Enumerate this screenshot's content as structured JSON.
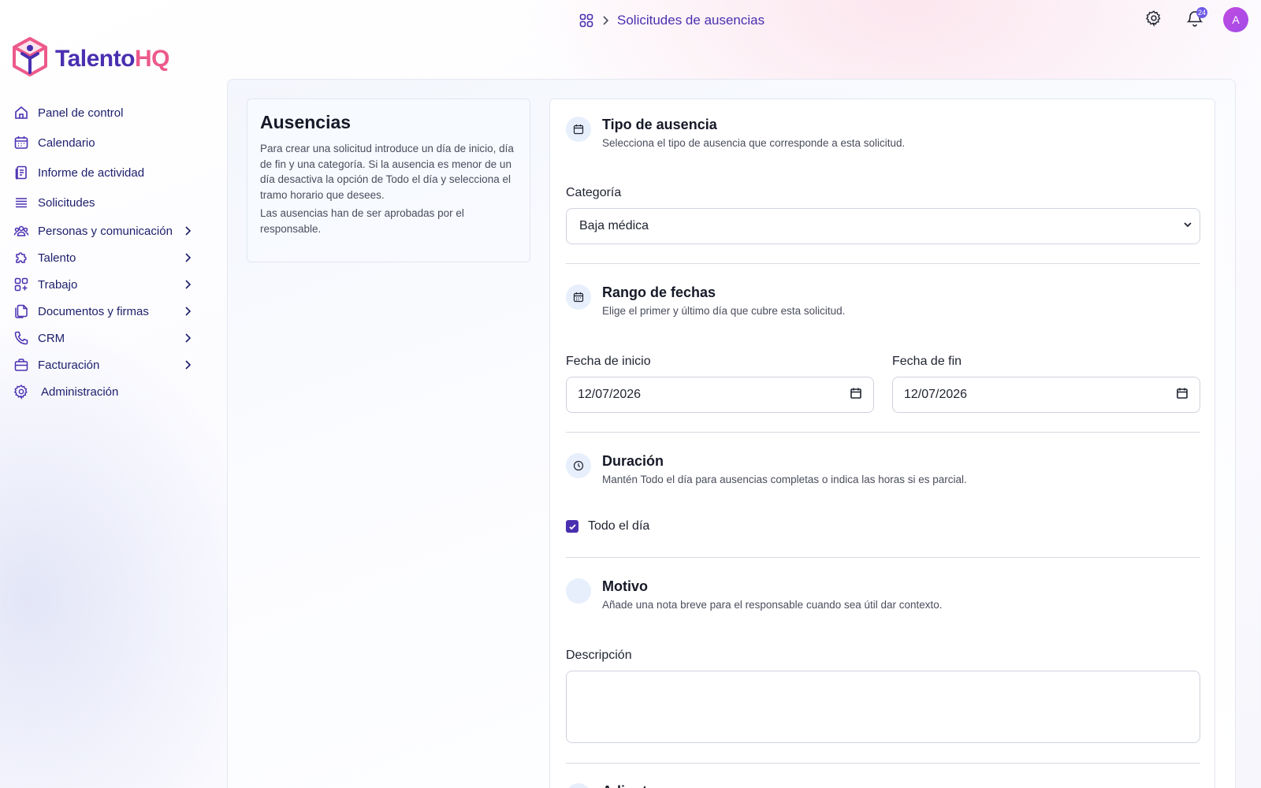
{
  "breadcrumb": {
    "current": "Solicitudes de ausencias"
  },
  "header": {
    "notifications_count": "24",
    "avatar_initial": "A"
  },
  "logo": {
    "part1": "Talento",
    "part2": "HQ"
  },
  "sidebar": {
    "items": [
      {
        "label": "Panel de control",
        "icon": "home-icon",
        "has_chevron": false
      },
      {
        "label": "Calendario",
        "icon": "calendar-icon",
        "has_chevron": false
      },
      {
        "label": "Informe de actividad",
        "icon": "report-icon",
        "has_chevron": false
      },
      {
        "label": "Solicitudes",
        "icon": "list-icon",
        "has_chevron": false
      },
      {
        "label": "Personas y comunicación",
        "icon": "users-icon",
        "has_chevron": true
      },
      {
        "label": "Talento",
        "icon": "puzzle-icon",
        "has_chevron": true
      },
      {
        "label": "Trabajo",
        "icon": "grid-plus-icon",
        "has_chevron": true
      },
      {
        "label": "Documentos y firmas",
        "icon": "documents-icon",
        "has_chevron": true
      },
      {
        "label": "CRM",
        "icon": "phone-icon",
        "has_chevron": true
      },
      {
        "label": "Facturación",
        "icon": "briefcase-icon",
        "has_chevron": true
      },
      {
        "label": "Administración",
        "icon": "gear-icon",
        "has_chevron": false
      }
    ]
  },
  "info": {
    "title": "Ausencias",
    "text1": "Para crear una solicitud introduce un día de inicio, día de fin y una categoría. Si la ausencia es menor de un día desactiva la opción de Todo el día y selecciona el tramo horario que desees.",
    "text2": "Las ausencias han de ser aprobadas por el responsable."
  },
  "form": {
    "type_section": {
      "title": "Tipo de ausencia",
      "subtitle": "Selecciona el tipo de ausencia que corresponde a esta solicitud."
    },
    "category": {
      "label": "Categoría",
      "value": "Baja médica"
    },
    "dates_section": {
      "title": "Rango de fechas",
      "subtitle": "Elige el primer y último día que cubre esta solicitud."
    },
    "start_date": {
      "label": "Fecha de inicio",
      "value": "12/07/2026"
    },
    "end_date": {
      "label": "Fecha de fin",
      "value": "12/07/2026"
    },
    "duration_section": {
      "title": "Duración",
      "subtitle": "Mantén Todo el día para ausencias completas o indica las horas si es parcial."
    },
    "all_day": {
      "label": "Todo el día",
      "checked": true
    },
    "reason_section": {
      "title": "Motivo",
      "subtitle": "Añade una nota breve para el responsable cuando sea útil dar contexto."
    },
    "description": {
      "label": "Descripción",
      "value": ""
    },
    "attachments_section": {
      "title": "Adjuntos"
    }
  },
  "colors": {
    "brand": "#4a2fb0",
    "accent": "#ec5a8a",
    "nav_text": "#1c1e6b"
  }
}
